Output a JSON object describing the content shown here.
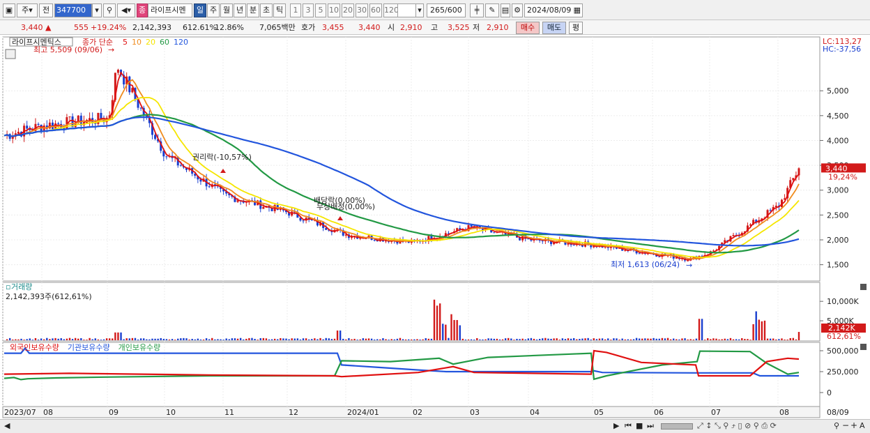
{
  "toolbar": {
    "period_main": "주",
    "mode": "전",
    "stock_code": "347700",
    "badge": "종",
    "stock_name": "라이프시멘",
    "periods": [
      "일",
      "주",
      "월",
      "년",
      "분",
      "초",
      "틱"
    ],
    "intervals": [
      "1",
      "3",
      "5",
      "10",
      "20",
      "30",
      "60",
      "120"
    ],
    "count": "265",
    "count_total": "/600",
    "date": "2024/08/09"
  },
  "quote": {
    "price": "3,440",
    "change": "555",
    "change_pct": "+19.24%",
    "volume": "2,142,393",
    "volume_ratio": "612.61%",
    "turnover_pct": "12.86%",
    "trade_value": "7,065백만",
    "ask_label": "호가",
    "ask_1": "3,455",
    "ask_2": "3,440",
    "open_label": "시",
    "open": "2,910",
    "high_label": "고",
    "high": "3,525",
    "low_label": "저",
    "low": "2,910",
    "buy_label": "매수",
    "sell_label": "매도",
    "eval_label": "평"
  },
  "chart": {
    "stock_tag": "라이프시멘틱스",
    "ma_label": "종가 단순",
    "ma_periods": [
      "5",
      "10",
      "20",
      "60",
      "120"
    ],
    "high_note": "최고 5,509 (09/06)",
    "low_note": "최저 1,613 (06/24)",
    "event_rights": "권리락(-10,57%)",
    "event_div": "배당락(0,00%)",
    "event_bonus": "무상배정(0,00%)",
    "lc": "LC:113,27",
    "hc": "HC:-37,56",
    "last_price": "3,440",
    "last_pct": "19,24%",
    "price_ticks": [
      "5,000",
      "4,500",
      "4,000",
      "3,500",
      "3,000",
      "2,500",
      "2,000",
      "1,500"
    ],
    "volume_title": "거래량",
    "volume_value": "2,142,393주(612,61%)",
    "volume_ticks": [
      "10,000K",
      "5,000K"
    ],
    "volume_last": "2,142K",
    "volume_last_pct": "612,61%",
    "holding_series": [
      "외국인보유수량",
      "기관보유수량",
      "개인보유수량"
    ],
    "holding_ticks": [
      "500,000",
      "250,000",
      "0"
    ],
    "x_labels": [
      "2023/07",
      "08",
      "09",
      "10",
      "11",
      "12",
      "2024/01",
      "02",
      "03",
      "04",
      "05",
      "06",
      "07",
      "08",
      "08/09"
    ]
  },
  "colors": {
    "up": "#d21a1a",
    "down": "#1a3fcf",
    "ma5": "#e01010",
    "ma10": "#f08c1e",
    "ma20": "#f5e600",
    "ma60": "#229944",
    "ma120": "#2255dd",
    "foreign": "#2255dd",
    "institution": "#229944",
    "individual": "#e01010"
  },
  "chart_data": {
    "type": "line",
    "price_axis": [
      1500,
      5500
    ],
    "anchors": [
      {
        "x": "2023/07",
        "close": 4100
      },
      {
        "x": "08",
        "close": 4300
      },
      {
        "x": "09",
        "close": 4450
      },
      {
        "x": "09/06",
        "close": 5509
      },
      {
        "x": "10",
        "close": 3700
      },
      {
        "x": "11",
        "close": 2900
      },
      {
        "x": "12",
        "close": 2550
      },
      {
        "x": "2024/01",
        "close": 2100
      },
      {
        "x": "02",
        "close": 1950
      },
      {
        "x": "03",
        "close": 2250
      },
      {
        "x": "04",
        "close": 2000
      },
      {
        "x": "05",
        "close": 1900
      },
      {
        "x": "06/24",
        "close": 1613
      },
      {
        "x": "07",
        "close": 1750
      },
      {
        "x": "08",
        "close": 2700
      },
      {
        "x": "08/09",
        "close": 3440
      }
    ]
  }
}
